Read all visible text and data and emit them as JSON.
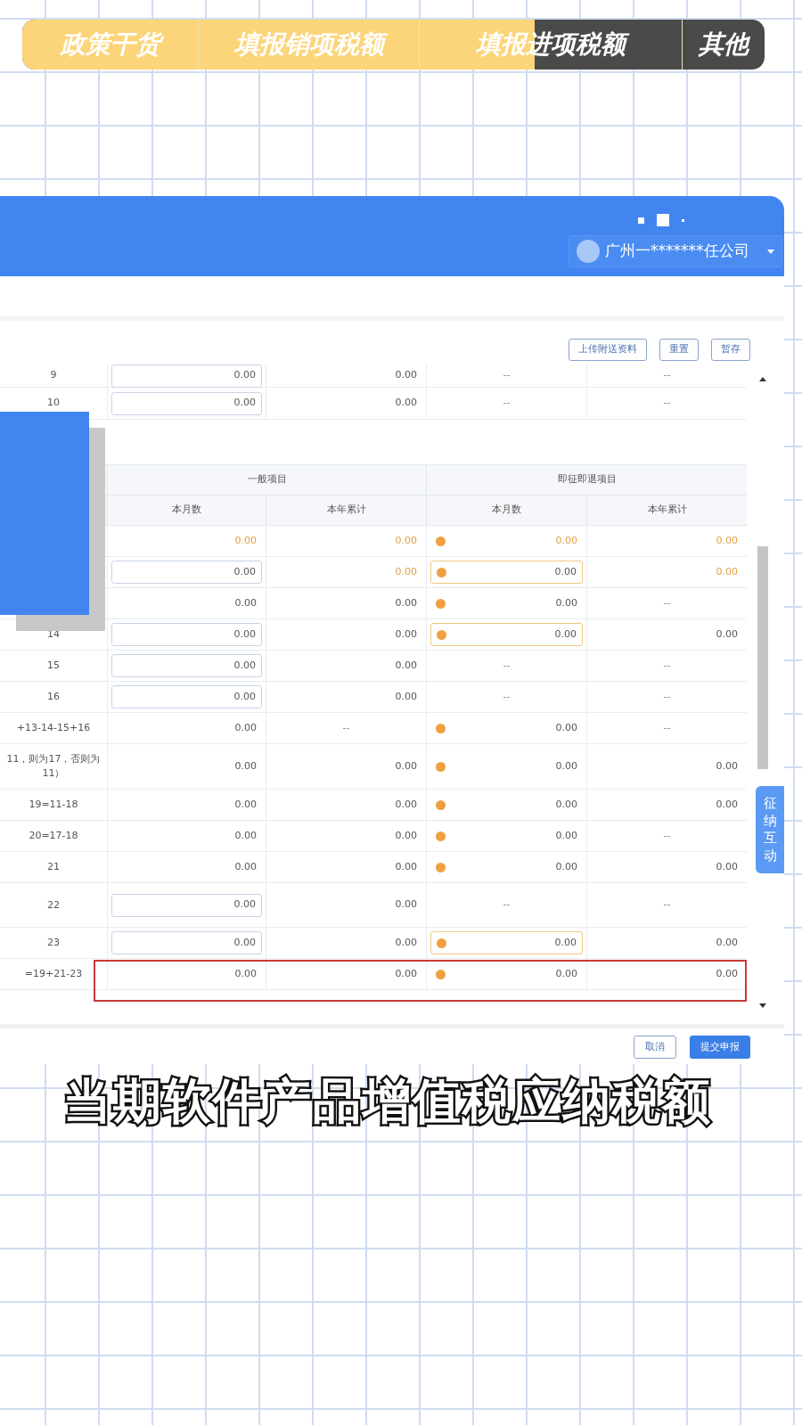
{
  "progress_tabs": {
    "level": 0.69,
    "tabs": [
      {
        "label": "政策干货"
      },
      {
        "label": "填报销项税额"
      },
      {
        "label": "填报进项税额"
      },
      {
        "label": "其他"
      }
    ]
  },
  "header": {
    "user": "广州一*******任公司"
  },
  "toolbar": {
    "buttons": [
      "上传附送资料",
      "重置",
      "暂存"
    ]
  },
  "top_rows": [
    {
      "label": "9",
      "cells": [
        {
          "kind": "input",
          "text": "0.00"
        },
        {
          "kind": "text",
          "text": "0.00"
        },
        {
          "kind": "dash",
          "text": "--"
        },
        {
          "kind": "dash",
          "text": "--"
        }
      ]
    },
    {
      "label": "10",
      "cells": [
        {
          "kind": "input",
          "text": "0.00"
        },
        {
          "kind": "text",
          "text": "0.00"
        },
        {
          "kind": "dash",
          "text": "--"
        },
        {
          "kind": "dash",
          "text": "--"
        }
      ]
    }
  ],
  "table": {
    "groups": [
      "一般项目",
      "即征即退项目"
    ],
    "columns": [
      "本月数",
      "本年累计",
      "本月数",
      "本年累计"
    ],
    "rows": [
      {
        "highlighted": false,
        "cells": [
          {
            "kind": "text",
            "text": "0.00",
            "computed": true
          },
          {
            "kind": "text",
            "text": "0.00",
            "computed": true
          },
          {
            "kind": "text",
            "text": "0.00",
            "computed": true,
            "dot": true
          },
          {
            "kind": "text",
            "text": "0.00",
            "computed": true
          }
        ]
      },
      {
        "highlighted": false,
        "cells": [
          {
            "kind": "input",
            "text": "0.00"
          },
          {
            "kind": "text",
            "text": "0.00",
            "computed": true
          },
          {
            "kind": "input",
            "text": "0.00",
            "dot": true
          },
          {
            "kind": "text",
            "text": "0.00",
            "computed": true
          }
        ]
      },
      {
        "highlighted": false,
        "cells": [
          {
            "kind": "text",
            "text": "0.00"
          },
          {
            "kind": "text",
            "text": "0.00"
          },
          {
            "kind": "text",
            "text": "0.00",
            "dot": true
          },
          {
            "kind": "dash",
            "text": "--"
          }
        ]
      },
      {
        "label": "14",
        "highlighted": false,
        "cells": [
          {
            "kind": "input",
            "text": "0.00"
          },
          {
            "kind": "text",
            "text": "0.00"
          },
          {
            "kind": "input",
            "text": "0.00",
            "dot": true
          },
          {
            "kind": "text",
            "text": "0.00"
          }
        ]
      },
      {
        "label": "15",
        "highlighted": false,
        "cells": [
          {
            "kind": "input",
            "text": "0.00"
          },
          {
            "kind": "text",
            "text": "0.00"
          },
          {
            "kind": "dash",
            "text": "--"
          },
          {
            "kind": "dash",
            "text": "--"
          }
        ]
      },
      {
        "label": "16",
        "highlighted": false,
        "cells": [
          {
            "kind": "input",
            "text": "0.00"
          },
          {
            "kind": "text",
            "text": "0.00"
          },
          {
            "kind": "dash",
            "text": "--"
          },
          {
            "kind": "dash",
            "text": "--"
          }
        ]
      },
      {
        "label": "+13-14-15+16",
        "highlighted": false,
        "cells": [
          {
            "kind": "text",
            "text": "0.00"
          },
          {
            "kind": "dash",
            "text": "--"
          },
          {
            "kind": "text",
            "text": "0.00",
            "dot": true
          },
          {
            "kind": "dash",
            "text": "--"
          }
        ]
      },
      {
        "label": "11，则为17，否则为 11）",
        "highlighted": false,
        "cells": [
          {
            "kind": "text",
            "text": "0.00"
          },
          {
            "kind": "text",
            "text": "0.00"
          },
          {
            "kind": "text",
            "text": "0.00",
            "dot": true
          },
          {
            "kind": "text",
            "text": "0.00"
          }
        ]
      },
      {
        "label": "19=11-18",
        "highlighted": false,
        "cells": [
          {
            "kind": "text",
            "text": "0.00"
          },
          {
            "kind": "text",
            "text": "0.00"
          },
          {
            "kind": "text",
            "text": "0.00",
            "dot": true
          },
          {
            "kind": "text",
            "text": "0.00"
          }
        ]
      },
      {
        "label": "20=17-18",
        "highlighted": false,
        "cells": [
          {
            "kind": "text",
            "text": "0.00"
          },
          {
            "kind": "text",
            "text": "0.00"
          },
          {
            "kind": "text",
            "text": "0.00",
            "dot": true
          },
          {
            "kind": "dash",
            "text": "--"
          }
        ]
      },
      {
        "label": "21",
        "highlighted": false,
        "cells": [
          {
            "kind": "text",
            "text": "0.00"
          },
          {
            "kind": "text",
            "text": "0.00"
          },
          {
            "kind": "text",
            "text": "0.00",
            "dot": true
          },
          {
            "kind": "text",
            "text": "0.00"
          }
        ]
      },
      {
        "label": "22",
        "highlighted": false,
        "cells": [
          {
            "kind": "input",
            "text": "0.00"
          },
          {
            "kind": "text",
            "text": "0.00"
          },
          {
            "kind": "dash",
            "text": "--"
          },
          {
            "kind": "dash",
            "text": "--"
          }
        ]
      },
      {
        "label": "23",
        "highlighted": false,
        "cells": [
          {
            "kind": "input",
            "text": "0.00"
          },
          {
            "kind": "text",
            "text": "0.00"
          },
          {
            "kind": "input",
            "text": "0.00",
            "dot": true
          },
          {
            "kind": "text",
            "text": "0.00"
          }
        ]
      },
      {
        "label": "=19+21-23",
        "highlighted": true,
        "cells": [
          {
            "kind": "text",
            "text": "0.00"
          },
          {
            "kind": "text",
            "text": "0.00"
          },
          {
            "kind": "text",
            "text": "0.00",
            "dot": true
          },
          {
            "kind": "text",
            "text": "0.00"
          }
        ]
      }
    ]
  },
  "side_button": "征纳互动",
  "footer": {
    "buttons": [
      {
        "label": "取消",
        "primary": false
      },
      {
        "label": "提交申报",
        "primary": true
      }
    ]
  },
  "subtitle": "当期软件产品增值税应纳税额"
}
